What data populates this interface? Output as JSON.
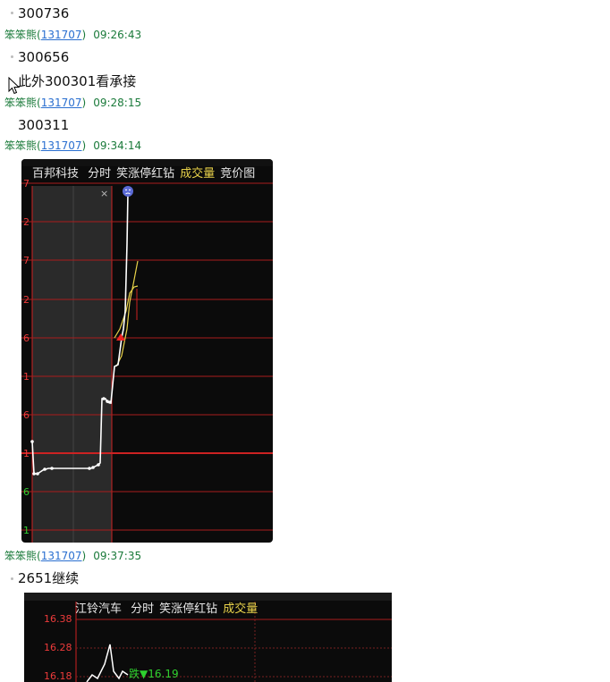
{
  "messages": [
    {
      "text": "300736"
    },
    {
      "text": "300656"
    },
    {
      "text": "此外300301看承接"
    },
    {
      "text": "300311"
    },
    {
      "text": "2651继续"
    }
  ],
  "meta": [
    {
      "nick": "笨笨熊",
      "uid": "131707",
      "time": "09:26:43"
    },
    {
      "nick": "笨笨熊",
      "uid": "131707",
      "time": "09:28:15"
    },
    {
      "nick": "笨笨熊",
      "uid": "131707",
      "time": "09:34:14"
    },
    {
      "nick": "笨笨熊",
      "uid": "131707",
      "time": "09:37:35"
    }
  ],
  "chart1": {
    "stock": "百邦科技",
    "tabs": [
      "分时",
      "笑涨停红钻",
      "成交量",
      "竞价图"
    ],
    "close_glyph": "×",
    "y_labels": [
      "7",
      "2",
      "7",
      "2",
      "6",
      "1",
      "6",
      "1",
      "6",
      "1"
    ],
    "colors": {
      "up": "#ee3b3b",
      "down": "#2fd12f",
      "price": "#ffffff",
      "avg": "#e8d24a"
    }
  },
  "chart2": {
    "stock": "江铃汽车",
    "tabs": [
      "分时",
      "笑涨停红钻",
      "成交量"
    ],
    "y_labels": [
      "16.38",
      "16.28",
      "16.18"
    ],
    "tooltip": "跌▼16.19"
  },
  "icons": {
    "cursor": "mouse-pointer-icon",
    "face": "sad-face-icon",
    "marker": "red-triangle-icon"
  }
}
